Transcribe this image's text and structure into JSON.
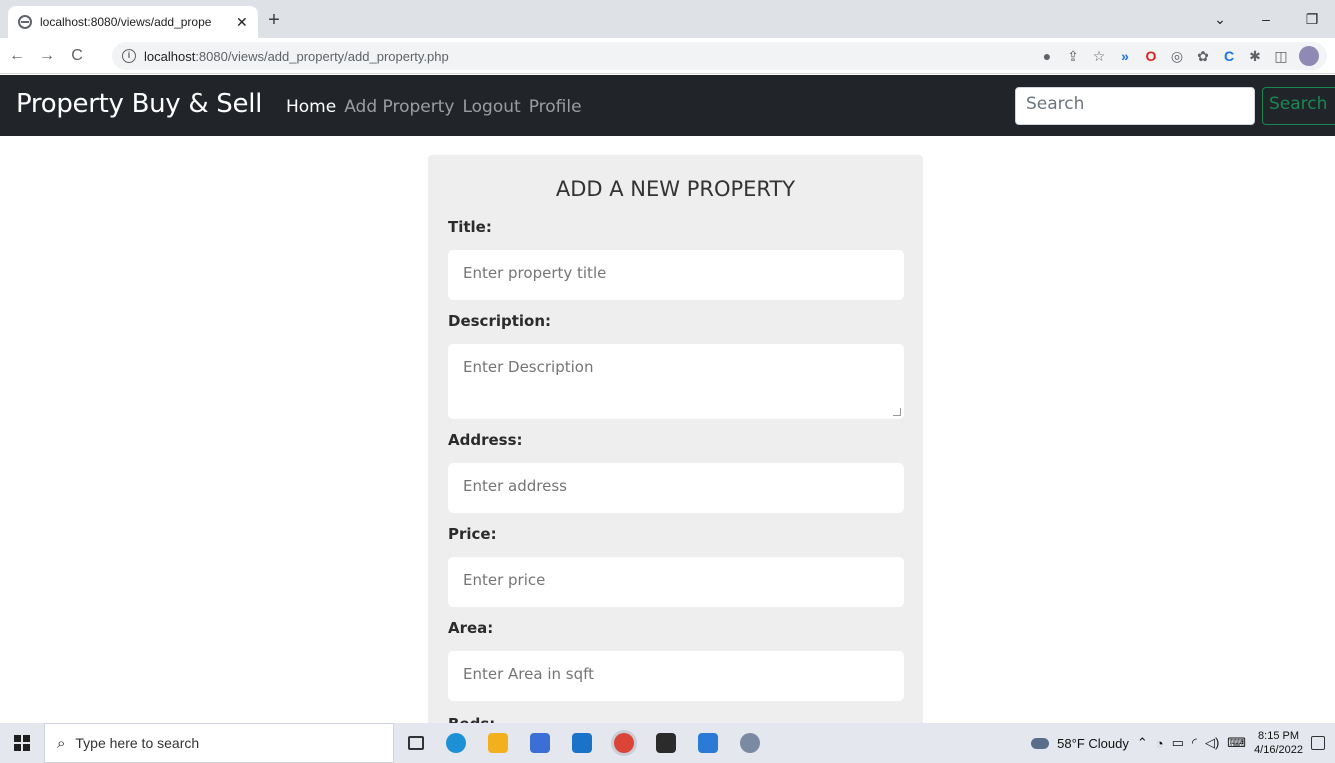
{
  "browser": {
    "tab_title": "localhost:8080/views/add_prope",
    "tab_close": "✕",
    "new_tab": "+",
    "url_host": "localhost",
    "url_rest": ":8080/views/add_property/add_property.php",
    "nav_back": "←",
    "nav_forward": "→",
    "nav_reload": "C",
    "info": "i",
    "window_controls": [
      "⌄",
      "–",
      "❐"
    ]
  },
  "navbar": {
    "brand": "Property Buy & Sell",
    "links": [
      "Home",
      "Add Property",
      "Logout",
      "Profile"
    ],
    "search_placeholder": "Search",
    "search_button": "Search"
  },
  "form": {
    "title": "ADD A NEW PROPERTY",
    "fields": [
      {
        "label": "Title:",
        "placeholder": "Enter property title"
      },
      {
        "label": "Description:",
        "placeholder": "Enter Description"
      },
      {
        "label": "Address:",
        "placeholder": "Enter address"
      },
      {
        "label": "Price:",
        "placeholder": "Enter price"
      },
      {
        "label": "Area:",
        "placeholder": "Enter Area in sqft"
      },
      {
        "label": "Beds:"
      }
    ]
  },
  "taskbar": {
    "search_text": "Type here to search",
    "weather": "58°F  Cloudy",
    "time": "8:15 PM",
    "date": "4/16/2022"
  },
  "colors": {
    "navbar_bg": "#212529",
    "search_button": "#198754",
    "card_bg": "#eeeeee"
  }
}
